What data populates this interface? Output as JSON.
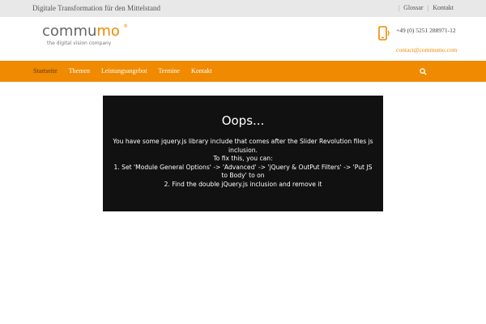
{
  "topbar": {
    "tagline": "Digitale Transformation für den Mittelstand",
    "links": [
      "Glossar",
      "Kontakt"
    ]
  },
  "header": {
    "logo": {
      "wordmark_main": "commu",
      "wordmark_accent": "mo",
      "registered": "®",
      "tagline": "the digital vision company"
    },
    "contact": {
      "icon": "mobile-phone-icon",
      "phone": "+49 (0) 5251 288971-12",
      "email": "contact@commumo.com"
    }
  },
  "nav": {
    "items": [
      {
        "label": "Startseite",
        "active": true
      },
      {
        "label": "Themen",
        "active": false
      },
      {
        "label": "Leistungsangebot",
        "active": false
      },
      {
        "label": "Termine",
        "active": false
      },
      {
        "label": "Kontakt",
        "active": false
      }
    ],
    "search_icon": "search-icon"
  },
  "error": {
    "title": "Oops...",
    "lines": [
      "You have some jquery.js library include that comes after the Slider Revolution files js inclusion.",
      "To fix this, you can:",
      "1. Set 'Module General Options' -> 'Advanced' -> 'jQuery & OutPut Filters' -> 'Put JS to Body' to on",
      "2. Find the double jQuery.js inclusion and remove it"
    ]
  },
  "colors": {
    "accent": "#f08a00",
    "topbar_bg": "#e8e8e8",
    "error_bg": "#111111"
  }
}
